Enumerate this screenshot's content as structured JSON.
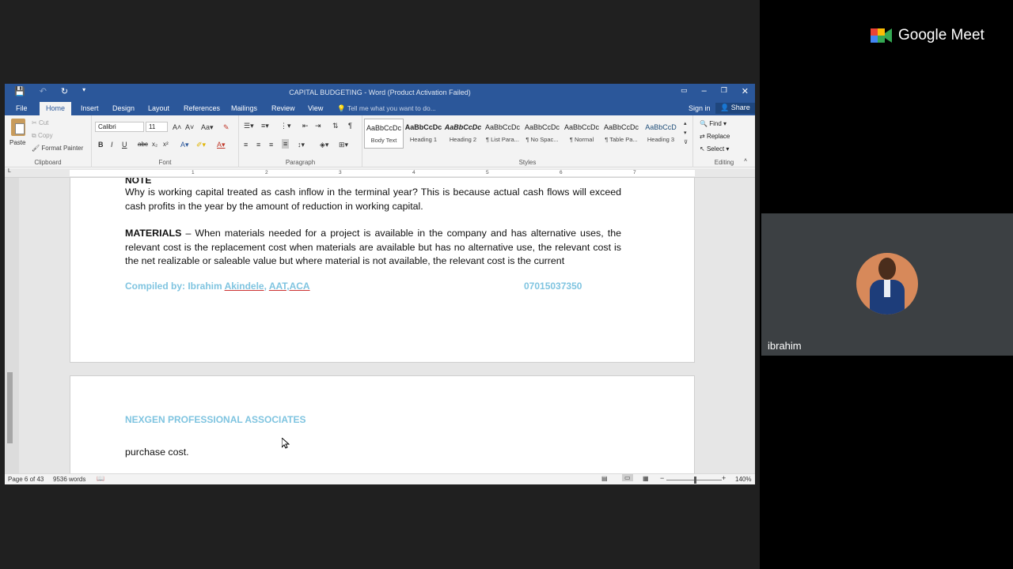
{
  "meet": {
    "brand": "Google Meet",
    "participant_name": "ibrahim"
  },
  "word": {
    "title": "CAPITAL BUDGETING - Word (Product Activation Failed)",
    "tabs": [
      "File",
      "Home",
      "Insert",
      "Design",
      "Layout",
      "References",
      "Mailings",
      "Review",
      "View"
    ],
    "active_tab": "Home",
    "tell_me": "Tell me what you want to do...",
    "sign_in": "Sign in",
    "share": "Share",
    "clipboard": {
      "paste": "Paste",
      "cut": "Cut",
      "copy": "Copy",
      "format_painter": "Format Painter",
      "group": "Clipboard"
    },
    "font": {
      "name": "Calibri",
      "size": "11",
      "group": "Font"
    },
    "paragraph": {
      "group": "Paragraph"
    },
    "styles": {
      "group": "Styles",
      "items": [
        {
          "preview": "AaBbCcDc",
          "name": "Body Text"
        },
        {
          "preview": "AaBbCcDc",
          "name": "Heading 1"
        },
        {
          "preview": "AaBbCcDc",
          "name": "Heading 2"
        },
        {
          "preview": "AaBbCcDc",
          "name": "¶ List Para..."
        },
        {
          "preview": "AaBbCcDc",
          "name": "¶ No Spac..."
        },
        {
          "preview": "AaBbCcDc",
          "name": "¶ Normal"
        },
        {
          "preview": "AaBbCcDc",
          "name": "¶ Table Pa..."
        },
        {
          "preview": "AaBbCcD",
          "name": "Heading 3"
        }
      ]
    },
    "editing": {
      "find": "Find",
      "replace": "Replace",
      "select": "Select",
      "group": "Editing"
    },
    "ruler_numbers": [
      "1",
      "2",
      "3",
      "4",
      "5",
      "6",
      "7"
    ],
    "doc": {
      "note": "NOTE",
      "para1": "Why is working capital treated as cash inflow in the terminal year? This is because actual cash flows will exceed cash profits in the year by the amount of reduction in working capital.",
      "materials_bold": "MATERIALS",
      "materials_text": " – When materials needed for a project is available in the company and has alternative uses, the relevant cost is the replacement cost when materials are available but has no alternative use, the relevant cost is the net realizable or saleable value but where material is not available, the relevant cost is the current",
      "footer_prefix": "Compiled by: Ibrahim ",
      "footer_name": "Akindele",
      "footer_sep": ", ",
      "footer_quals": "AAT,ACA",
      "phone": "07015037350",
      "header2": "NEXGEN PROFESSIONAL ASSOCIATES",
      "para2": "purchase cost."
    },
    "status": {
      "page": "Page 6 of 43",
      "words": "9536 words",
      "zoom": "140%"
    }
  }
}
